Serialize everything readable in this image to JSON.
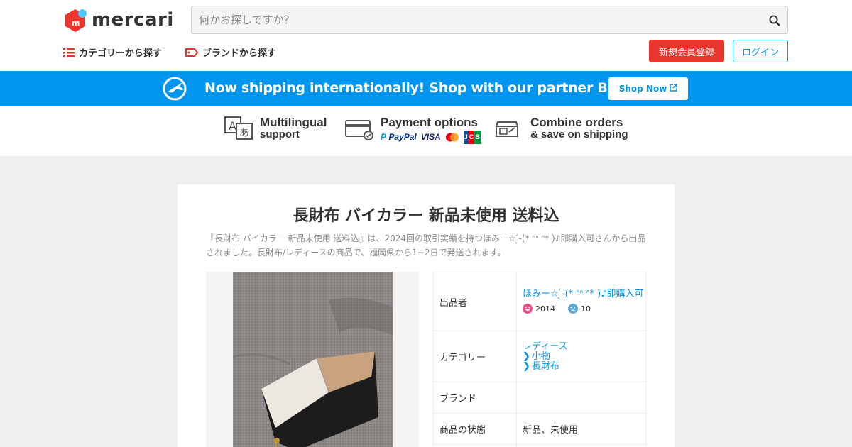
{
  "header": {
    "logo_text": "mercari",
    "search_placeholder": "何かお探しですか？",
    "nav_category": "カテゴリーから探す",
    "nav_brand": "ブランドから探す",
    "signup_label": "新規会員登録",
    "login_label": "ログイン"
  },
  "banner": {
    "text": "Now shipping internationally! Shop with our partner Buyee!",
    "button_label": "Shop Now"
  },
  "features": {
    "multilingual": [
      "Multilingual",
      "support"
    ],
    "payment": "Payment options",
    "payment_logos": [
      "PayPal",
      "VISA",
      "JCB"
    ],
    "combine": [
      "Combine orders",
      "& save on shipping"
    ]
  },
  "item": {
    "title": "長財布 バイカラー 新品未使用 送料込",
    "description": "『長財布 バイカラー 新品未使用 送料込』は、2024回の取引実績を持つほみー☆ ̖́-(* ᐢᐢ ᐢ* )♪即購入可さんから出品されました。長財布/レディースの商品で、福岡県から1~2日で発送されます。",
    "details": {
      "seller_label": "出品者",
      "seller_name": "ほみー☆ ̖́-(* ᐢᐢ ᐢ* )♪即購入可",
      "good_count": "2014",
      "bad_count": "10",
      "category_label": "カテゴリー",
      "category_1": "レディース",
      "category_2": "小物",
      "category_3": "長財布",
      "brand_label": "ブランド",
      "brand_value": "",
      "condition_label": "商品の状態",
      "condition_value": "新品、未使用"
    }
  },
  "colors": {
    "brand_red": "#ea352d",
    "accent_blue": "#0095ee"
  }
}
